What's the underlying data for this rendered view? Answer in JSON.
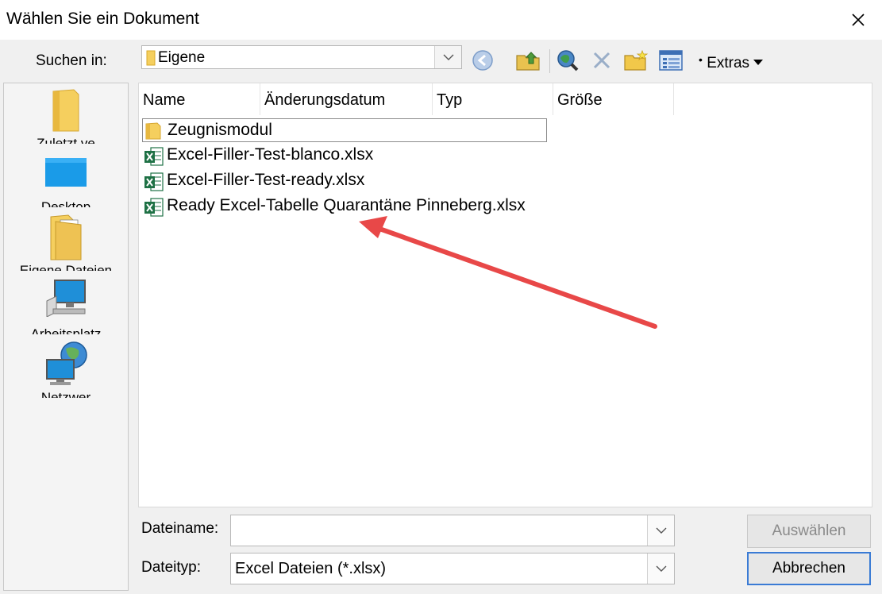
{
  "window": {
    "title": "Wählen Sie ein Dokument",
    "close_glyph": "✕"
  },
  "toolbar": {
    "look_in_label": "Suchen in:",
    "look_in_value": "Eigene",
    "extras_label": "Extras",
    "icons": [
      "back-icon",
      "up-folder-icon",
      "search-web-icon",
      "delete-icon",
      "new-folder-icon",
      "view-menu-icon"
    ]
  },
  "places": [
    {
      "label": "Zuletzt ve",
      "icon": "folder-icon"
    },
    {
      "label": "Desktop",
      "icon": "desktop-icon"
    },
    {
      "label": "Eigene Dateien",
      "icon": "documents-icon"
    },
    {
      "label": "Arbeitsplatz",
      "icon": "computer-icon"
    },
    {
      "label": "Netzwer",
      "icon": "network-icon"
    }
  ],
  "columns": [
    "Name",
    "Änderungsdatum",
    "Typ",
    "Größe"
  ],
  "files": [
    {
      "name": "Zeugnismodul",
      "kind": "folder"
    },
    {
      "name": "Excel-Filler-Test-blanco.xlsx",
      "kind": "excel"
    },
    {
      "name": "Excel-Filler-Test-ready.xlsx",
      "kind": "excel"
    },
    {
      "name": "Ready Excel-Tabelle Quarantäne Pinneberg.xlsx",
      "kind": "excel"
    }
  ],
  "bottom": {
    "filename_label": "Dateiname:",
    "filename_value": "",
    "filetype_label": "Dateityp:",
    "filetype_value": "Excel Dateien (*.xlsx)",
    "open_button": "Auswählen",
    "cancel_button": "Abbrechen"
  },
  "colors": {
    "annotation_arrow": "#e84848",
    "excel_green": "#1e7145",
    "folder_yellow": "#f5cf5e"
  }
}
